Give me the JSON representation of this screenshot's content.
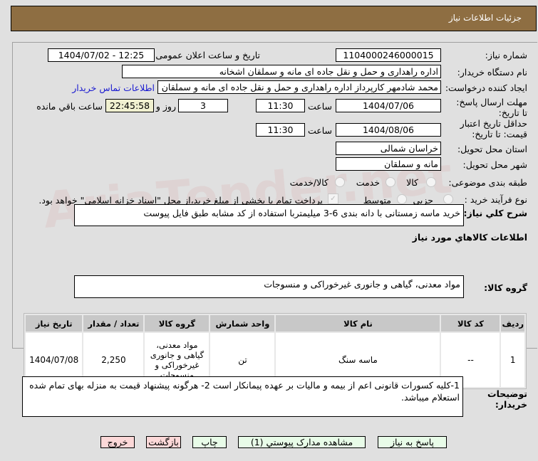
{
  "header": {
    "title": "جزئیات اطلاعات نیاز"
  },
  "form": {
    "need_number_label": "شماره نیاز:",
    "need_number": "1104000246000015",
    "announce_label": "تاریخ و ساعت اعلان عمومی:",
    "announce_value": "1404/07/02 - 12:25",
    "buyer_label": "نام دستگاه خریدار:",
    "buyer_value": "اداره راهداری و حمل و نقل جاده ای مانه و سملقان  اشخانه",
    "creator_label": "ایجاد کننده درخواست:",
    "creator_value": "محمد شادمهر کارپرداز اداره راهداری و حمل و نقل جاده ای مانه و سملقان  اشخانه",
    "contact_link": "اطلاعات تماس خریدار",
    "deadline_label": "مهلت ارسال پاسخ: تا تاریخ:",
    "deadline_date": "1404/07/06",
    "time_label": "ساعت",
    "deadline_time": "11:30",
    "days": "3",
    "days_label": "روز و",
    "remaining": "22:45:58",
    "remaining_label": "ساعت باقي مانده",
    "validity_label": "حداقل تاریخ اعتبار قیمت: تا تاریخ:",
    "validity_date": "1404/08/06",
    "validity_time": "11:30",
    "province_label": "استان محل تحویل:",
    "province": "خراسان شمالی",
    "city_label": "شهر محل تحویل:",
    "city": "مانه و سملقان",
    "category_label": "طبقه بندی موضوعی:",
    "category_options": [
      "کالا",
      "خدمت",
      "کالا/خدمت"
    ],
    "process_label": "نوع فرآیند خرید :",
    "process_options": [
      "جزیی",
      "متوسط"
    ],
    "payment_note": "پرداخت تمام یا بخشی از مبلغ خرید،از محل \"اسناد خزانه اسلامی\" خواهد بود.",
    "description_label": "شرح کلي نیاز:",
    "description": "خرید ماسه زمستانی با دانه بندی 6-3 میلیمتربا استفاده از کد مشابه طبق فایل پیوست",
    "goods_heading": "اطلاعات کالاهاي مورد نیاز",
    "group_label": "گروه کالا:",
    "group_value": "مواد معدنی، گیاهی و جانوری غیرخوراکی و منسوجات"
  },
  "table": {
    "headers": [
      "ردیف",
      "کد کالا",
      "نام کالا",
      "واحد شمارش",
      "گروه کالا",
      "تعداد / مقدار",
      "تاریخ نیاز"
    ],
    "rows": [
      [
        "1",
        "--",
        "ماسه سنگ",
        "تن",
        "مواد معدنی، گیاهی و جانوری غیرخوراکی و منسوجات",
        "2,250",
        "1404/07/08"
      ]
    ]
  },
  "notes": {
    "label": "توضیحات خریدار:",
    "text": "1-کلیه کسورات قانونی اعم از بیمه و مالیات بر عهده پیمانکار است 2- هرگونه پیشنهاد قیمت به منزله بهای تمام شده استعلام میباشد."
  },
  "buttons": {
    "reply": "پاسخ به نیاز",
    "attachments": "مشاهده مدارک پیوستي (1)",
    "print": "چاپ",
    "back": "بازگشت",
    "exit": "خروج"
  },
  "watermark": "AriaTender.net"
}
